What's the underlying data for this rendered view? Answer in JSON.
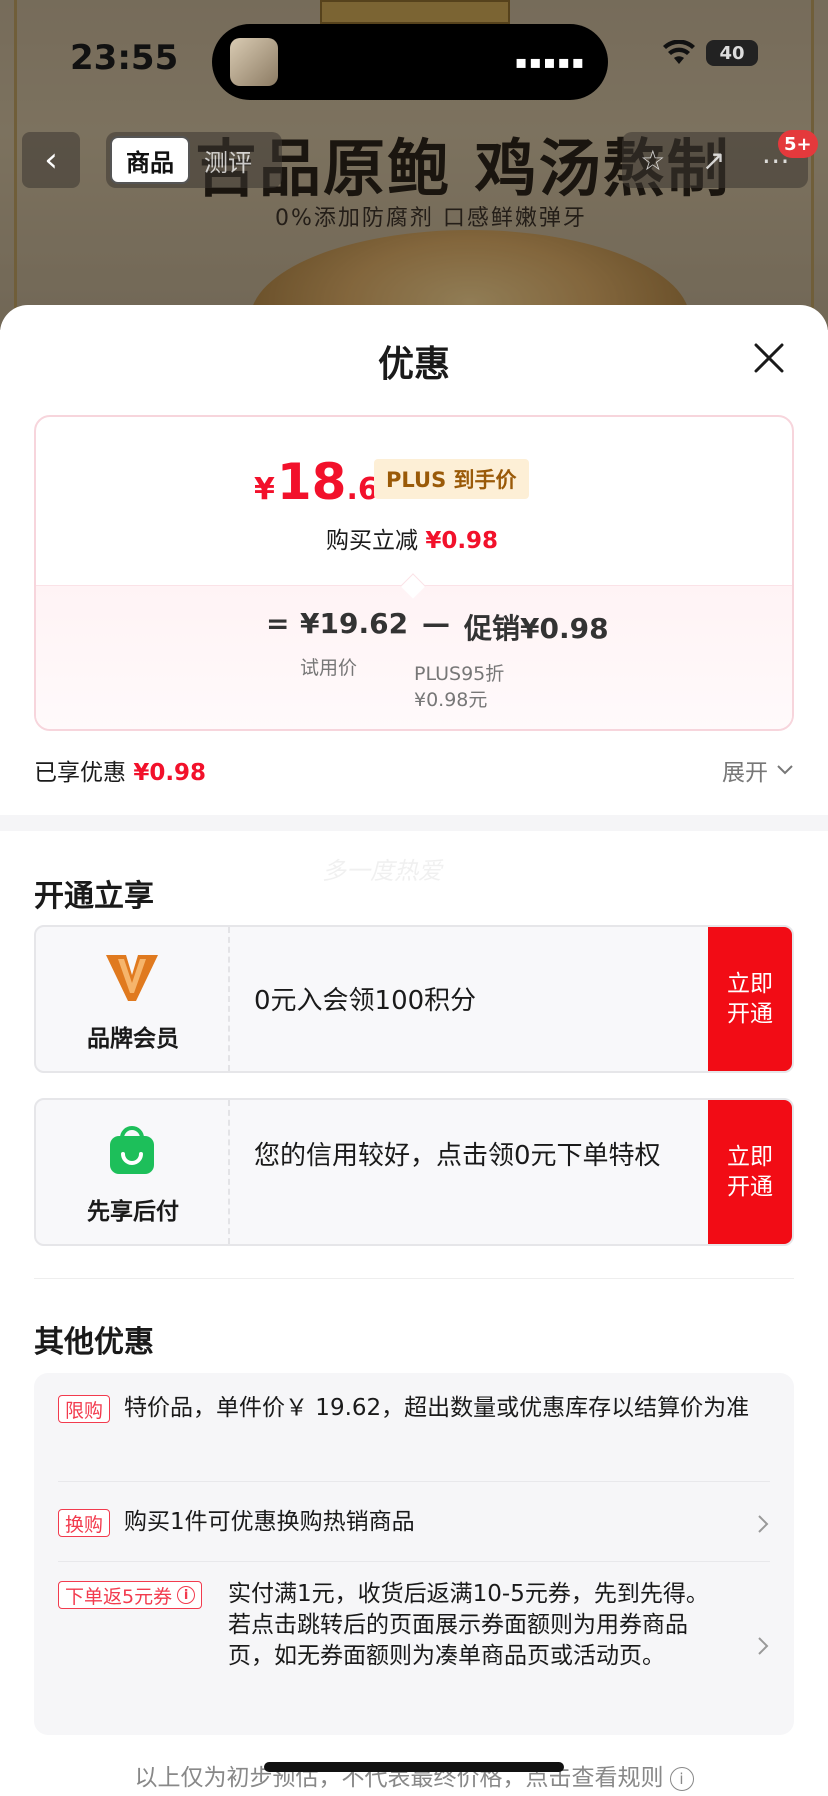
{
  "status_bar": {
    "time": "23:55",
    "battery": "40"
  },
  "background_page": {
    "title": "吉品原鲍 鸡汤熬制",
    "subtitle": "0%添加防腐剂 口感鲜嫩弹牙",
    "tabs": [
      "商品",
      "测评"
    ],
    "cart_badge": "5+"
  },
  "sheet": {
    "title": "优惠",
    "price": {
      "currency": "¥",
      "integer": "18",
      "decimal": ".64",
      "tag": "PLUS 到手价",
      "buy_reduce_label": "购买立减",
      "buy_reduce_value": "¥0.98",
      "formula": {
        "equals": "=",
        "base_price": "¥19.62",
        "base_label": "试用价",
        "minus": "—",
        "promo_prefix": "促销",
        "promo_value": "¥0.98",
        "promo_detail_1": "PLUS95折",
        "promo_detail_2": "¥0.98元"
      }
    },
    "enjoyed_label": "已享优惠",
    "enjoyed_value": "¥0.98",
    "expand_label": "展开",
    "watermark": "多一度热爱",
    "membership": {
      "title": "开通立享",
      "offers": [
        {
          "name": "品牌会员",
          "icon": "brand-v-icon",
          "text": "0元入会领100积分",
          "button": "立即开通"
        },
        {
          "name": "先享后付",
          "icon": "shopping-bag-icon",
          "text": "您的信用较好，点击领0元下单特权",
          "button": "立即开通"
        }
      ]
    },
    "other": {
      "title": "其他优惠",
      "items": [
        {
          "tag": "限购",
          "text": "特价品，单件价￥ 19.62，超出数量或优惠库存以结算价为准"
        },
        {
          "tag": "换购",
          "text": "购买1件可优惠换购热销商品"
        },
        {
          "tag": "下单返5元券",
          "text": "实付满1元，收货后返满10-5元券，先到先得。若点击跳转后的页面展示券面额则为用券商品页，如无券面额则为凑单商品页或活动页。"
        }
      ]
    },
    "footer": "以上仅为初步预估，不代表最终价格，点击查看规则"
  },
  "colors": {
    "accent_red": "#f2112b",
    "button_red": "#f20c15",
    "plus_gold": "#9a5a08",
    "pay_green": "#1dbf5a",
    "brand_orange": "#e07a1f"
  }
}
